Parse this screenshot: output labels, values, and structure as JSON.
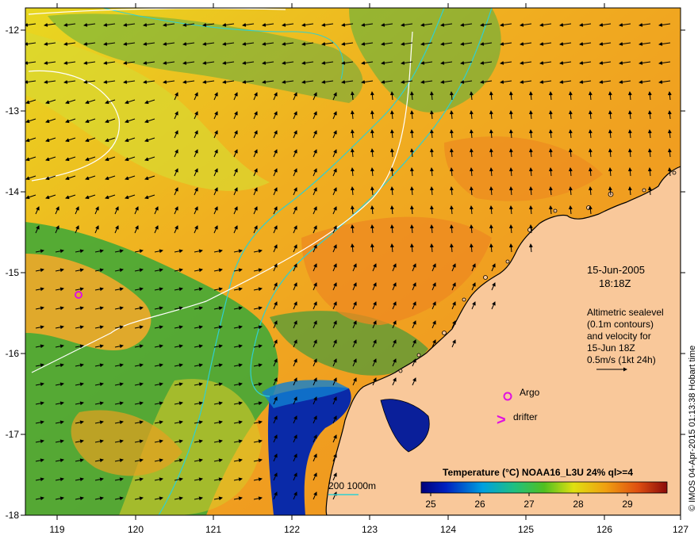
{
  "map": {
    "x_ticks": [
      "119",
      "120",
      "121",
      "122",
      "123",
      "124",
      "125",
      "126",
      "127"
    ],
    "y_ticks": [
      "-12",
      "-13",
      "-14",
      "-15",
      "-16",
      "-17",
      "-18"
    ],
    "lon_range": [
      118.6,
      127
    ],
    "lat_range": [
      -18,
      -11.8
    ]
  },
  "annotations": {
    "date": "15-Jun-2005",
    "time": "18:18Z",
    "altimetry_line1": "Altimetric sealevel",
    "altimetry_line2": "(0.1m contours)",
    "altimetry_line3": "and velocity for",
    "altimetry_line4": "15-Jun 18Z",
    "velocity_scale": "0.5m/s (1kt 24h)",
    "argo_label": "Argo",
    "drifter_label": "drifter",
    "drifter_symbol": ">",
    "depth_label": "200  1000m"
  },
  "colorbar": {
    "title": "Temperature (°C) NOAA16_L3U 24% ql>=4",
    "ticks": [
      "25",
      "26",
      "27",
      "28",
      "29"
    ],
    "range": [
      24.7,
      29.7
    ]
  },
  "credit": "© IMOS 04-Apr-2015 01:13:38 Hobart time",
  "colors": {
    "land": "#f9c89a",
    "sst_orange": "#f08a1c",
    "sst_yellow": "#e6e020",
    "sst_green": "#28a040",
    "sst_blue": "#0a1f9a",
    "contour_cyan": "#30d0d0",
    "argo_magenta": "#e010e0"
  }
}
